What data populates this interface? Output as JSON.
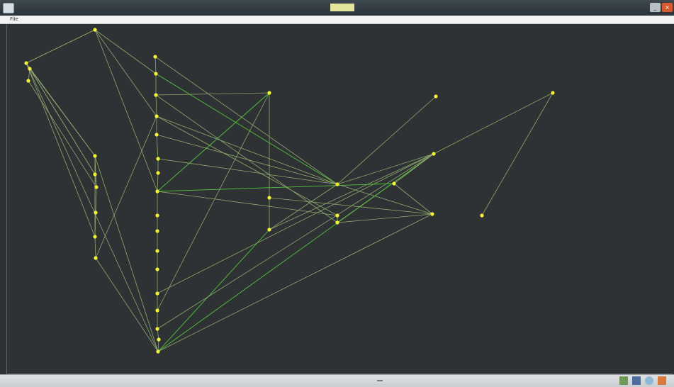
{
  "window": {
    "title": "",
    "icon": "app-icon",
    "minimize_icon": "minimize-icon",
    "close_icon": "close-icon"
  },
  "menu": {
    "file": "File"
  },
  "graph": {
    "nodes": [
      {
        "id": "n1",
        "label": ""
      },
      {
        "id": "n2",
        "label": ""
      },
      {
        "id": "n3",
        "label": ""
      },
      {
        "id": "n4",
        "label": ""
      },
      {
        "id": "n5",
        "label": ""
      },
      {
        "id": "n6",
        "label": ""
      },
      {
        "id": "n7",
        "label": ""
      },
      {
        "id": "n8",
        "label": ""
      },
      {
        "id": "n9",
        "label": ""
      },
      {
        "id": "n10",
        "label": ""
      },
      {
        "id": "n11",
        "label": ""
      },
      {
        "id": "n12",
        "label": ""
      },
      {
        "id": "n13",
        "label": ""
      },
      {
        "id": "n14",
        "label": ""
      },
      {
        "id": "n15",
        "label": ""
      },
      {
        "id": "n16",
        "label": ""
      },
      {
        "id": "n17",
        "label": ""
      },
      {
        "id": "n18",
        "label": ""
      },
      {
        "id": "n19",
        "label": ""
      },
      {
        "id": "n20",
        "label": ""
      },
      {
        "id": "n21",
        "label": ""
      },
      {
        "id": "n22",
        "label": ""
      },
      {
        "id": "n23",
        "label": ""
      },
      {
        "id": "n24",
        "label": ""
      },
      {
        "id": "n25",
        "label": ""
      },
      {
        "id": "n26",
        "label": ""
      },
      {
        "id": "n27",
        "label": ""
      },
      {
        "id": "n28",
        "label": ""
      },
      {
        "id": "n29",
        "label": ""
      },
      {
        "id": "n30",
        "label": ""
      },
      {
        "id": "n31",
        "label": ""
      },
      {
        "id": "n32",
        "label": ""
      },
      {
        "id": "n33",
        "label": ""
      },
      {
        "id": "n34",
        "label": ""
      },
      {
        "id": "n35",
        "label": ""
      }
    ],
    "edges": [
      [
        "n1",
        "n2",
        ""
      ],
      [
        "n1",
        "n3",
        ""
      ],
      [
        "n1",
        "n5",
        ""
      ],
      [
        "n1",
        "n6",
        ""
      ],
      [
        "n1",
        "n27",
        ""
      ],
      [
        "n1",
        "n9",
        ""
      ],
      [
        "n3",
        "n4",
        ""
      ],
      [
        "n3",
        "n5",
        ""
      ],
      [
        "n3",
        "n6",
        ""
      ],
      [
        "n4",
        "n7",
        ""
      ],
      [
        "n5",
        "n6",
        ""
      ],
      [
        "n6",
        "n7",
        ""
      ],
      [
        "n7",
        "n8",
        ""
      ],
      [
        "n8",
        "n9",
        ""
      ],
      [
        "n9",
        "n10",
        ""
      ],
      [
        "n10",
        "n27",
        ""
      ],
      [
        "n11",
        "n12",
        ""
      ],
      [
        "n12",
        "n13",
        ""
      ],
      [
        "n13",
        "n14",
        ""
      ],
      [
        "n14",
        "n15",
        ""
      ],
      [
        "n15",
        "n16",
        ""
      ],
      [
        "n16",
        "n17",
        ""
      ],
      [
        "n17",
        "n18",
        ""
      ],
      [
        "n18",
        "n19",
        ""
      ],
      [
        "n19",
        "n20",
        ""
      ],
      [
        "n20",
        "n21",
        ""
      ],
      [
        "n21",
        "n22",
        ""
      ],
      [
        "n22",
        "n23",
        ""
      ],
      [
        "n23",
        "n24",
        ""
      ],
      [
        "n24",
        "n25",
        ""
      ],
      [
        "n25",
        "n26",
        ""
      ],
      [
        "n26",
        "n27",
        ""
      ],
      [
        "n2",
        "n18",
        ""
      ],
      [
        "n2",
        "n1",
        ""
      ],
      [
        "n2",
        "n14",
        ""
      ],
      [
        "n28",
        "n29",
        ""
      ],
      [
        "n29",
        "n30",
        ""
      ],
      [
        "n28",
        "n18",
        ""
      ],
      [
        "n28",
        "n24",
        ""
      ],
      [
        "n28",
        "n13",
        ""
      ],
      [
        "n12",
        "n31",
        ""
      ],
      [
        "n14",
        "n32",
        ""
      ],
      [
        "n13",
        "n33",
        ""
      ],
      [
        "n15",
        "n31",
        ""
      ],
      [
        "n16",
        "n31",
        ""
      ],
      [
        "n31",
        "n34",
        ""
      ],
      [
        "n31",
        "n35",
        ""
      ],
      [
        "n31",
        "n30",
        ""
      ],
      [
        "n29",
        "n34",
        ""
      ],
      [
        "n30",
        "n35",
        ""
      ],
      [
        "n33",
        "n34",
        ""
      ],
      [
        "n33",
        "n32",
        ""
      ],
      [
        "n33",
        "n35",
        ""
      ],
      [
        "n34",
        "n36",
        ""
      ],
      [
        "n32",
        "n33",
        ""
      ],
      [
        "n35",
        "n27",
        ""
      ],
      [
        "n30",
        "n27",
        ""
      ],
      [
        "n34",
        "n27",
        ""
      ],
      [
        "n35",
        "n23",
        ""
      ],
      [
        "n35",
        "n25",
        ""
      ],
      [
        "n38",
        "n35",
        ""
      ],
      [
        "n38",
        "n39",
        ""
      ],
      [
        "n36",
        "n35",
        ""
      ],
      [
        "n37",
        "n31",
        ""
      ],
      [
        "n11",
        "n31",
        ""
      ],
      [
        "n12",
        "n2",
        ""
      ],
      [
        "n10",
        "n14",
        ""
      ],
      [
        "n6",
        "n9",
        ""
      ],
      [
        "n7",
        "n5",
        ""
      ],
      [
        "n5",
        "n27",
        ""
      ],
      [
        "n32",
        "n18",
        ""
      ],
      [
        "n36",
        "n18",
        ""
      ],
      [
        "n14",
        "n31",
        ""
      ]
    ]
  },
  "status": {
    "text": ""
  },
  "tray": {
    "icons": [
      "network-icon",
      "app-tray-icon",
      "chat-icon",
      "flag-icon"
    ]
  },
  "colors": {
    "background": "#2e3234",
    "node": "#f5f238",
    "edge": "#90a86e",
    "edge_bright": "#53c43c",
    "title_highlight": "#e3e69a",
    "close_button": "#d65a2e"
  }
}
